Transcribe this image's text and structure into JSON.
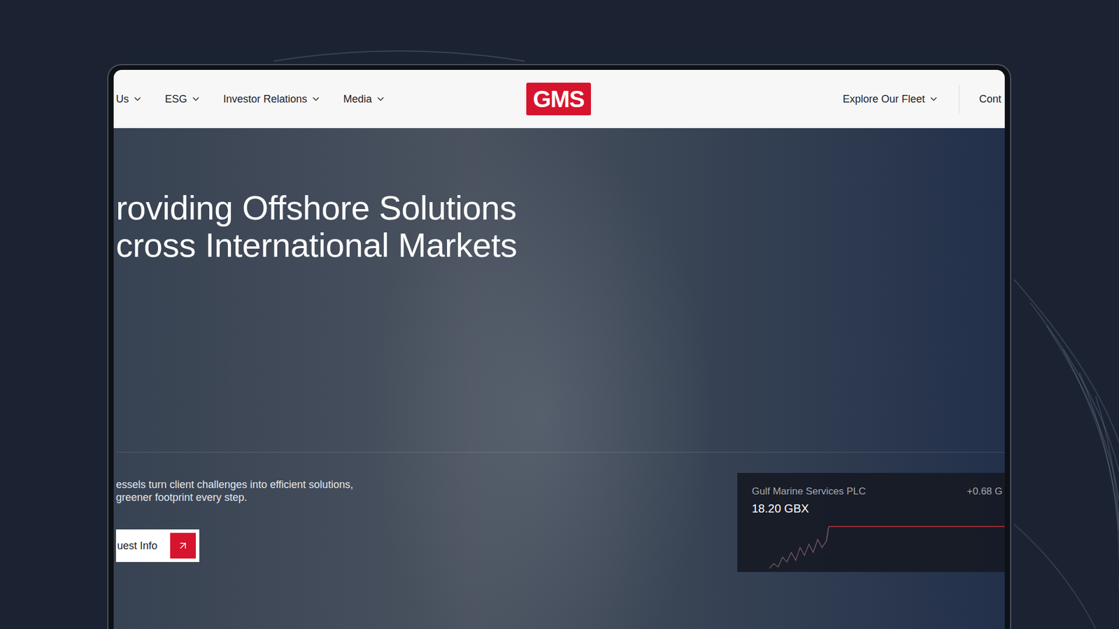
{
  "nav": {
    "left_items": [
      {
        "label": "Us"
      },
      {
        "label": "ESG"
      },
      {
        "label": "Investor Relations"
      },
      {
        "label": "Media"
      }
    ],
    "logo": "GMS",
    "right_items": [
      {
        "label": "Explore Our Fleet"
      }
    ],
    "contact": "Cont"
  },
  "hero": {
    "headline": [
      "roviding Offshore Solutions",
      "cross International Markets"
    ],
    "subtext": [
      "essels turn client challenges into efficient solutions,",
      "greener footprint every step."
    ],
    "button": "uest Info"
  },
  "stock": {
    "name": "Gulf Marine Services PLC",
    "change": "+0.68 G",
    "price": "18.20 GBX",
    "chart": {
      "series": [
        {
          "name": "history",
          "color": "#6e5660",
          "values": [
            15.6,
            15.9,
            15.7,
            16.3,
            16.0,
            16.6,
            16.1,
            16.9,
            16.4,
            17.1,
            16.6,
            17.4,
            16.9,
            17.3
          ]
        },
        {
          "name": "recent",
          "color": "#c8323c",
          "values": [
            18.2,
            18.2,
            18.2,
            18.2,
            18.2,
            18.2,
            18.2,
            18.2
          ]
        }
      ]
    }
  }
}
